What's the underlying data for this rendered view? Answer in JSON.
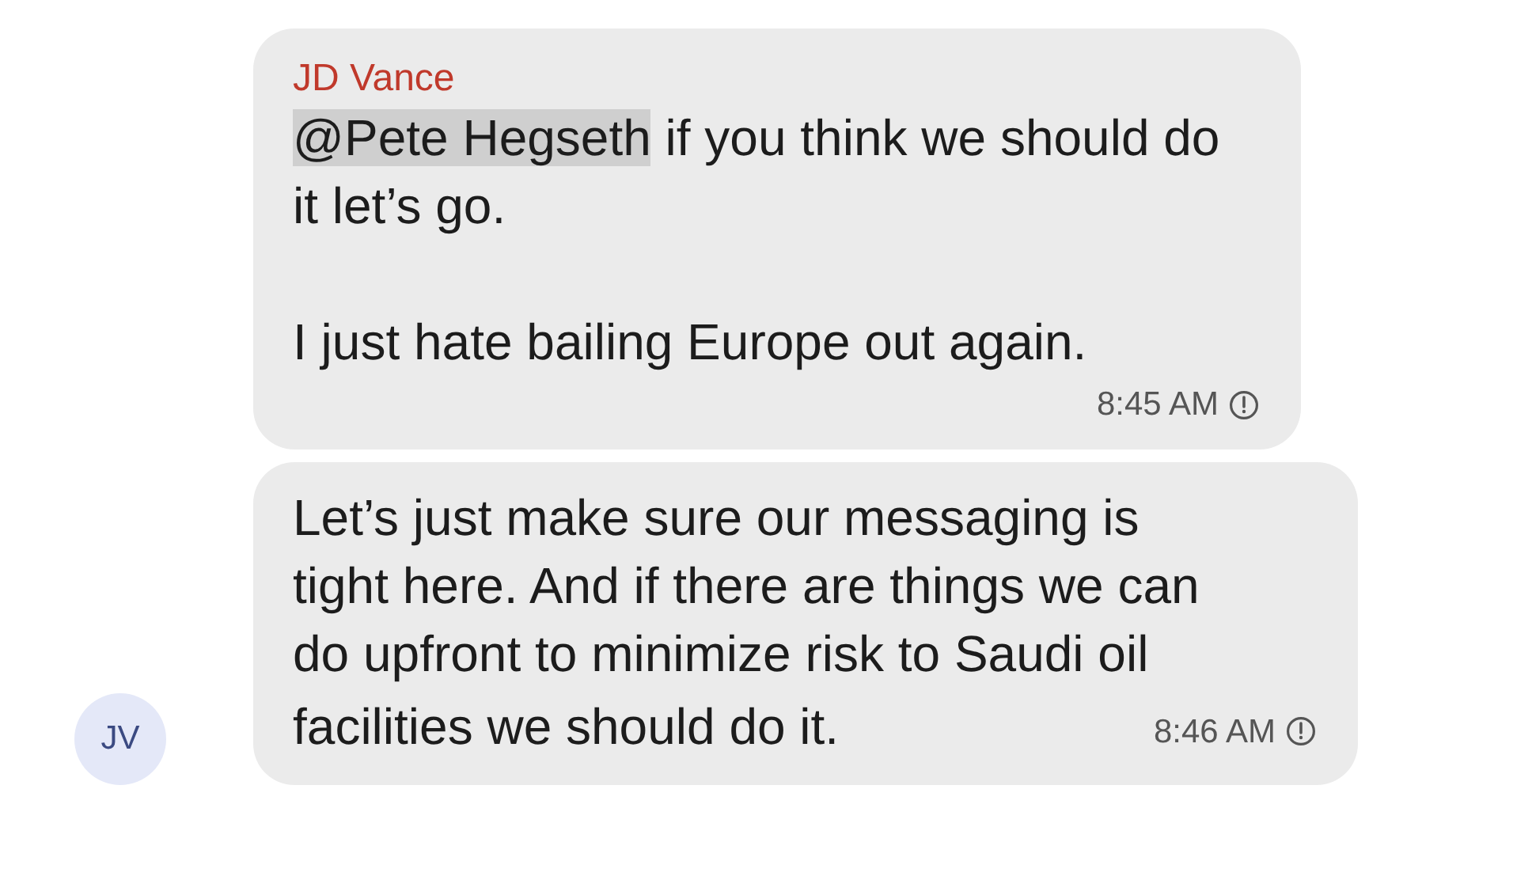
{
  "messages": [
    {
      "kind": "stacked",
      "sender": "JD Vance",
      "paragraphs": [
        {
          "mention": "@Pete Hegseth",
          "text": " if you think we should do it let’s go."
        },
        {
          "text": "I just hate bailing Europe out again."
        }
      ],
      "time": "8:45 AM"
    },
    {
      "kind": "inline",
      "lines": [
        "Let’s just make sure our messaging is",
        "tight here. And if there are things we can",
        "do upfront to minimize risk to Saudi oil",
        "facilities we should do it."
      ],
      "time": "8:46 AM",
      "avatar": "JV"
    }
  ]
}
